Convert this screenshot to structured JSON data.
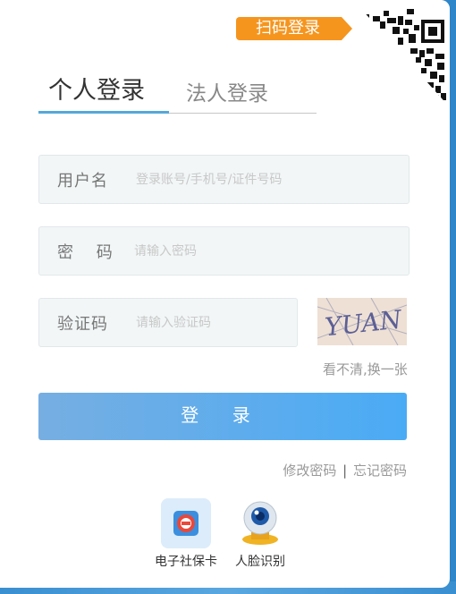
{
  "qr": {
    "badge_label": "扫码登录"
  },
  "tabs": [
    {
      "label": "个人登录",
      "active": true
    },
    {
      "label": "法人登录",
      "active": false
    }
  ],
  "form": {
    "username": {
      "label": "用户名",
      "placeholder": "登录账号/手机号/证件号码"
    },
    "password": {
      "label": "密 码",
      "placeholder": "请输入密码"
    },
    "captcha": {
      "label": "验证码",
      "placeholder": "请输入验证码",
      "image_text": "YUAN",
      "refresh_label": "看不清,换一张"
    }
  },
  "login_button": "登 录",
  "links": {
    "change_password": "修改密码",
    "separator": "|",
    "forgot_password": "忘记密码"
  },
  "alt_methods": [
    {
      "label": "电子社保卡",
      "icon": "social-security-card-icon"
    },
    {
      "label": "人脸识别",
      "icon": "face-recognition-icon"
    }
  ],
  "colors": {
    "accent": "#55a8d8",
    "badge": "#f5951e",
    "button_start": "#76aee2",
    "button_end": "#4aabf5"
  }
}
